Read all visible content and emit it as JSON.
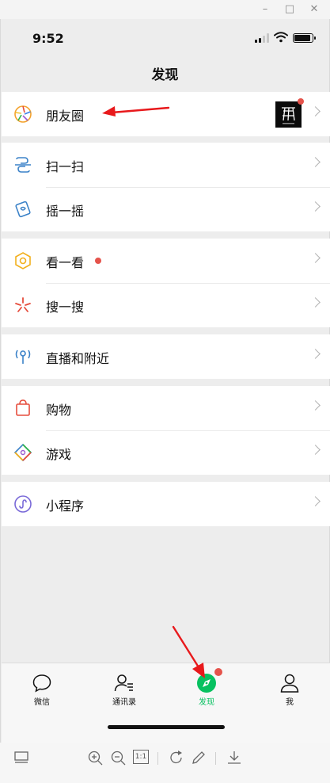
{
  "status_bar": {
    "time": "9:52"
  },
  "nav": {
    "title": "发现"
  },
  "menu": {
    "moments": "朋友圈",
    "scan": "扫一扫",
    "shake": "摇一摇",
    "top_stories": "看一看",
    "search": "搜一搜",
    "live_nearby": "直播和附近",
    "shopping": "购物",
    "games": "游戏",
    "mini_programs": "小程序"
  },
  "tabbar": {
    "chats": "微信",
    "contacts": "通讯录",
    "discover": "发现",
    "me": "我",
    "active": "discover"
  },
  "toolbar": {
    "actual_size": "1:1"
  },
  "colors": {
    "accent_green": "#07c160",
    "badge_red": "#e5534b",
    "annotation_red": "#e8191c",
    "background": "#ededed"
  },
  "icons": [
    "moments-icon",
    "scan-icon",
    "shake-icon",
    "top-stories-icon",
    "search-icon",
    "live-nearby-icon",
    "shopping-icon",
    "games-icon",
    "mini-programs-icon",
    "chats-icon",
    "contacts-icon",
    "discover-compass-icon",
    "me-icon"
  ]
}
